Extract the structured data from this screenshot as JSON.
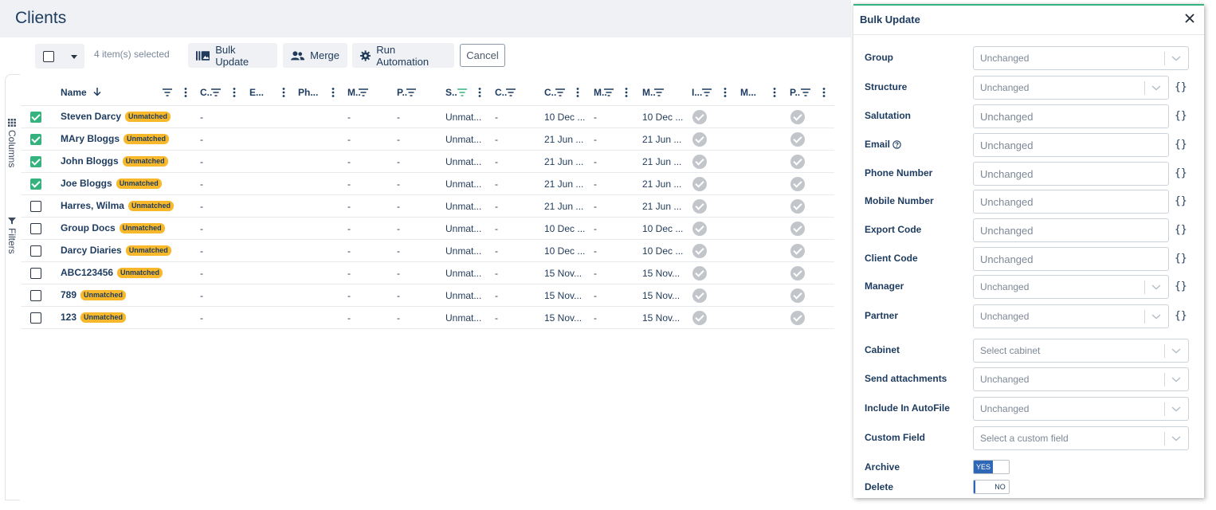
{
  "page": {
    "title": "Clients"
  },
  "toolbar": {
    "selected_count": "4 item(s) selected",
    "bulk_update": "Bulk Update",
    "merge": "Merge",
    "run_automation": "Run Automation",
    "cancel": "Cancel"
  },
  "side_tabs": {
    "columns": "Columns",
    "filters": "Filters"
  },
  "grid": {
    "columns": [
      "Name",
      "C..",
      "E...",
      "Ph...",
      "M..",
      "P..",
      "S..",
      "C..",
      "C..",
      "M..",
      "M..",
      "I...",
      "M...",
      "P.."
    ],
    "rows": [
      {
        "checked": true,
        "name": "Steven Darcy",
        "badge": "Unmatched",
        "c1": "-",
        "m1": "-",
        "p1": "-",
        "s": "Unmat...",
        "c2": "-",
        "c3": "10 Dec ...",
        "m2": "-",
        "m3": "10 Dec ..."
      },
      {
        "checked": true,
        "name": "MAry Bloggs",
        "badge": "Unmatched",
        "c1": "-",
        "m1": "-",
        "p1": "-",
        "s": "Unmat...",
        "c2": "-",
        "c3": "21 Jun ...",
        "m2": "-",
        "m3": "21 Jun ..."
      },
      {
        "checked": true,
        "name": "John Bloggs",
        "badge": "Unmatched",
        "c1": "-",
        "m1": "-",
        "p1": "-",
        "s": "Unmat...",
        "c2": "-",
        "c3": "21 Jun ...",
        "m2": "-",
        "m3": "21 Jun ..."
      },
      {
        "checked": true,
        "name": "Joe Bloggs",
        "badge": "Unmatched",
        "c1": "-",
        "m1": "-",
        "p1": "-",
        "s": "Unmat...",
        "c2": "-",
        "c3": "21 Jun ...",
        "m2": "-",
        "m3": "21 Jun ..."
      },
      {
        "checked": false,
        "name": "Harres, Wilma",
        "badge": "Unmatched",
        "c1": "-",
        "m1": "-",
        "p1": "-",
        "s": "Unmat...",
        "c2": "-",
        "c3": "21 Jun ...",
        "m2": "-",
        "m3": "21 Jun ..."
      },
      {
        "checked": false,
        "name": "Group Docs",
        "badge": "Unmatched",
        "c1": "-",
        "m1": "-",
        "p1": "-",
        "s": "Unmat...",
        "c2": "-",
        "c3": "10 Dec ...",
        "m2": "-",
        "m3": "10 Dec ..."
      },
      {
        "checked": false,
        "name": "Darcy Diaries",
        "badge": "Unmatched",
        "c1": "-",
        "m1": "-",
        "p1": "-",
        "s": "Unmat...",
        "c2": "-",
        "c3": "10 Dec ...",
        "m2": "-",
        "m3": "10 Dec ..."
      },
      {
        "checked": false,
        "name": "ABC123456",
        "badge": "Unmatched",
        "c1": "-",
        "m1": "-",
        "p1": "-",
        "s": "Unmat...",
        "c2": "-",
        "c3": "15 Nov...",
        "m2": "-",
        "m3": "15 Nov..."
      },
      {
        "checked": false,
        "name": "789",
        "badge": "Unmatched",
        "c1": "-",
        "m1": "-",
        "p1": "-",
        "s": "Unmat...",
        "c2": "-",
        "c3": "15 Nov...",
        "m2": "-",
        "m3": "15 Nov..."
      },
      {
        "checked": false,
        "name": "123",
        "badge": "Unmatched",
        "c1": "-",
        "m1": "-",
        "p1": "-",
        "s": "Unmat...",
        "c2": "-",
        "c3": "15 Nov...",
        "m2": "-",
        "m3": "15 Nov..."
      }
    ]
  },
  "panel": {
    "title": "Bulk Update",
    "fields": [
      {
        "label": "Group",
        "value": "Unchanged",
        "kind": "select",
        "expr": false
      },
      {
        "label": "Structure",
        "value": "Unchanged",
        "kind": "select",
        "expr": true
      },
      {
        "label": "Salutation",
        "value": "Unchanged",
        "kind": "text",
        "expr": true
      },
      {
        "label": "Email",
        "value": "Unchanged",
        "kind": "text",
        "expr": true,
        "help": true
      },
      {
        "label": "Phone Number",
        "value": "Unchanged",
        "kind": "text",
        "expr": true
      },
      {
        "label": "Mobile Number",
        "value": "Unchanged",
        "kind": "text",
        "expr": true
      },
      {
        "label": "Export Code",
        "value": "Unchanged",
        "kind": "text",
        "expr": true
      },
      {
        "label": "Client Code",
        "value": "Unchanged",
        "kind": "text",
        "expr": true
      },
      {
        "label": "Manager",
        "value": "Unchanged",
        "kind": "select",
        "expr": true
      },
      {
        "label": "Partner",
        "value": "Unchanged",
        "kind": "select",
        "expr": true
      },
      {
        "label": "Cabinet",
        "value": "Select cabinet",
        "kind": "select",
        "expr": false
      },
      {
        "label": "Send attachments",
        "value": "Unchanged",
        "kind": "select",
        "expr": false
      },
      {
        "label": "Include In AutoFile",
        "value": "Unchanged",
        "kind": "select",
        "expr": false
      },
      {
        "label": "Custom Field",
        "value": "Select a custom field",
        "kind": "select",
        "expr": false
      }
    ],
    "archive": {
      "label": "Archive",
      "toggle": "YES"
    },
    "delete": {
      "label": "Delete",
      "toggle": "NO"
    },
    "expr_glyph": "{}"
  },
  "colors": {
    "accent": "#35b37e",
    "badge": "#f7b92b",
    "primary_text": "#1d3b5f",
    "toggle_on": "#2f67b7"
  }
}
